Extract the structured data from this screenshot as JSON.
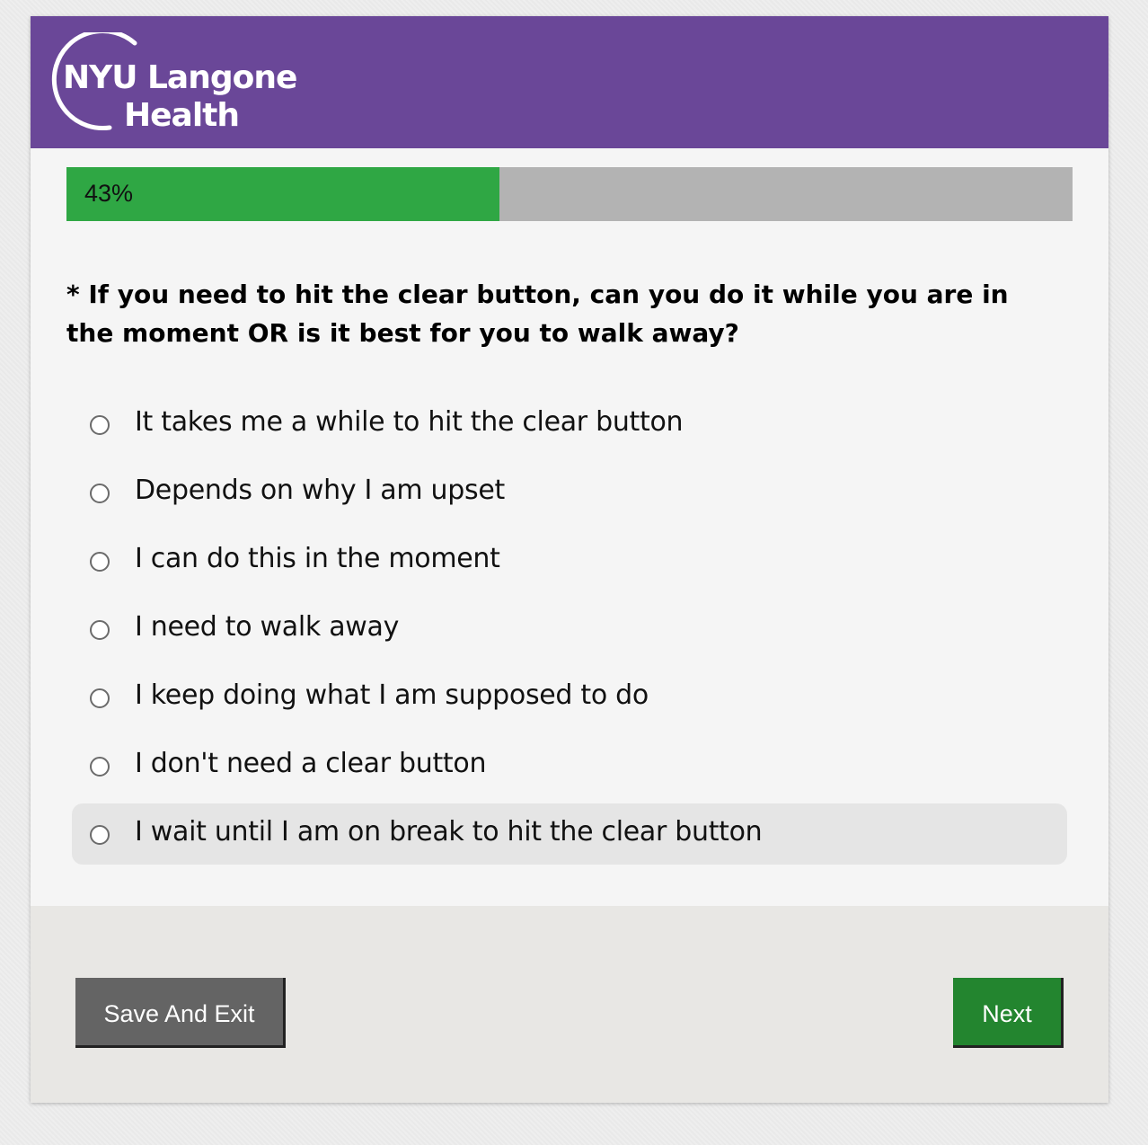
{
  "header": {
    "logo_line1": "NYU Langone",
    "logo_line2": "Health",
    "background_color": "#6a4798"
  },
  "progress": {
    "label": "43%",
    "value_percent": 43,
    "fill_color": "#2fa744"
  },
  "question": {
    "text": "* If you need to hit the clear button, can you do it while you are in the moment OR is it best for you to walk away?"
  },
  "choices": [
    {
      "label": "It takes me a while to hit the clear button",
      "selected": false,
      "hovered": false
    },
    {
      "label": "Depends on why I am upset",
      "selected": false,
      "hovered": false
    },
    {
      "label": "I can do this in the moment",
      "selected": false,
      "hovered": false
    },
    {
      "label": "I need to walk away",
      "selected": false,
      "hovered": false
    },
    {
      "label": "I keep doing what I am supposed to do",
      "selected": false,
      "hovered": false
    },
    {
      "label": "I don't need a clear button",
      "selected": false,
      "hovered": false
    },
    {
      "label": "I wait until I am on break to hit the clear button",
      "selected": false,
      "hovered": true
    }
  ],
  "footer": {
    "save_exit_label": "Save And Exit",
    "next_label": "Next"
  }
}
